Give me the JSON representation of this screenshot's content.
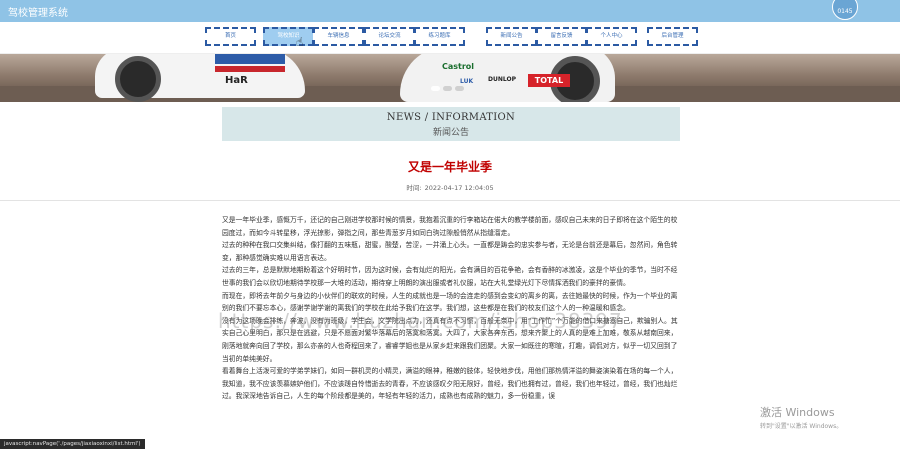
{
  "header": {
    "site_title": "驾校管理系统",
    "clock_text": "0145"
  },
  "nav": {
    "items": [
      {
        "label": "首页"
      },
      {
        "label": "驾校知识",
        "active": true
      },
      {
        "label": "车辆信息"
      },
      {
        "label": "论坛交流"
      },
      {
        "label": "练习题库"
      },
      {
        "label": "新闻公告"
      },
      {
        "label": "留言反馈"
      },
      {
        "label": "个人中心"
      },
      {
        "label": "后台管理"
      }
    ]
  },
  "banner": {
    "logos": {
      "castrol": "Castrol",
      "dunlop": "DUNLOP",
      "total": "TOTAL",
      "lok": "LUK",
      "car_number": "HaR"
    },
    "carousel_dots": 3,
    "active_dot": 0
  },
  "section": {
    "title_en": "NEWS / INFORMATION",
    "title_cn": "新闻公告"
  },
  "article": {
    "title": "又是一年毕业季",
    "time_label": "时间:",
    "time_value": "2022-04-17 12:04:05",
    "paragraphs": [
      "又是一年毕业季，感慨万千，还记的自己刚进学校那时候的情景，我抱着沉重的行李箱站在偌大的教学楼前面，感叹自己未来的日子即将在这个陌生的校园度过，而如今斗转星移，浮光掠影，弹指之间，那些青葱岁月如同白驹过隙般悄然从指缝溜走。",
      "过去的种种在我口交集纠结，像打翻的五味瓶，甜蜜，酸楚，苦涩，一并涌上心头。一直都是踌会的忠实参与者，无论是台前还是幕后，忽然间，角色转变，那种感觉确实难以用语言表达。",
      "过去的三年，总是默默地期盼着这个好明时节，因为这时候，会有灿烂的阳光，会有满目的百花争艳，会有香醉的冰激凌，这是个毕业的季节，当时不经世事的我们会以欣切地期待学校那一大堆的活动，期待穿上明朗的演出服或者礼仪服，站在大礼堂绿光灯下尽情挥洒我们的豪拌的豪情。",
      "而现在，即将去年前夕与身边的小伙伴们的联欢的时候，人生的成就也是一场的会连走的感到会变幻的离乡的离，去往她最快的时候，作为一个毕业的离别的我们不要忘本心，感谢学谢学谢的离我们的学校在此给予我们在这学。我们想，这些都是在我们的校友们这个人的一种温暖和感念。",
      "没有为这场晚会排练，奔波，没有为班级，学生会，文学院出点力，还真有点不习惯，百般无奈中，用“工作忙”个万能的借口来搪塞自己，欺骗别人。其实自己心里明白，那只是在逃避，只是不愿面对繁华落幕后的落寞和落寞。大四了，大家各奔东西，想来齐聚上的人真的是难上加难，敬系从越南回来，刚落地就奔向回了学校，那么亦亲的人也奇程回来了，睿睿学姐也是从家乡赶来跟我们团聚。大家一如既往的寒暄，打趣，调侃对方，似乎一切又回到了当初的单纯美好。",
      "看着舞台上活泼可爱的学弟学妹们，如同一群机灵的小精灵，满溢的眼神，稚嫩的肢体，轻快地步伐，用他们那热情洋溢的舞姿演染着在场的每一个人，我知道，我不应该羡慕嫉妒他们，不应该蹉自怜惜逝去的青春，不应该感叹夕阳无限好，曾经，我们也拥有过，曾经，我们也年轻过，曾经，我们也灿烂过。我深深地告诉自己，人生的每个阶段都是美的，年轻有年轻的活力，成熟也有成熟的魅力，多一份稳重，误"
    ]
  },
  "watermark": "https://www.huzhan.com/ishop38397",
  "activation": {
    "title": "激活 Windows",
    "subtitle": "转到\"设置\"以激活 Windows。"
  },
  "status_bar": "javascript:navPage('./pages/jiaxiaoxinxi/list.html')"
}
